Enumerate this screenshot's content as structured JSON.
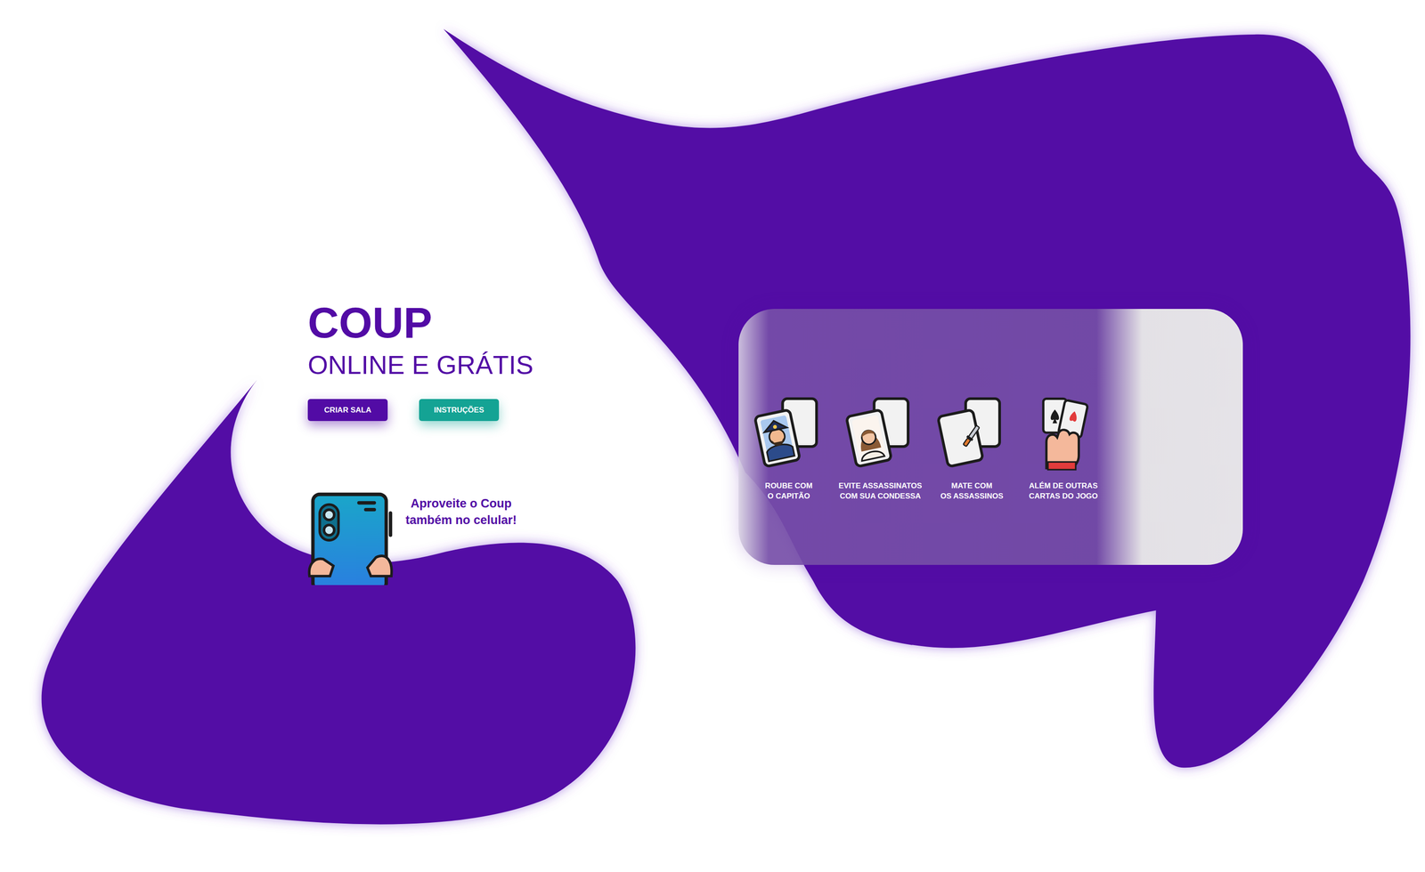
{
  "hero": {
    "title": "COUP",
    "subtitle": "ONLINE E GRÁTIS",
    "buttons": [
      {
        "label": "CRIAR SALA",
        "kind": "primary"
      },
      {
        "label": "INSTRUÇÕES",
        "kind": "secondary"
      }
    ]
  },
  "mobile": {
    "lines": [
      "Aproveite o Coup",
      "também no celular!"
    ]
  },
  "features": [
    {
      "lines": [
        "ROUBE COM",
        "O CAPITÃO"
      ],
      "kind": "captain"
    },
    {
      "lines": [
        "EVITE ASSASSINATOS",
        "COM SUA CONDESSA"
      ],
      "kind": "contessa"
    },
    {
      "lines": [
        "MATE COM",
        "OS ASSASSINOS"
      ],
      "kind": "assassin"
    },
    {
      "lines": [
        "ALÉM DE OUTRAS",
        "CARTAS DO JOGO"
      ],
      "kind": "cards"
    }
  ]
}
